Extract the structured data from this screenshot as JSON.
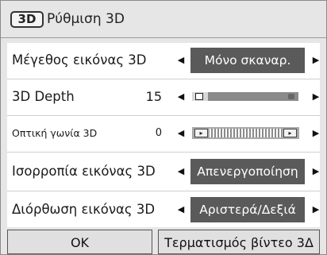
{
  "title": {
    "logo_text": "3D",
    "text": "Ρύθμιση 3D"
  },
  "rows": [
    {
      "label": "Μέγεθος εικόνας 3D",
      "value": "",
      "control": "select",
      "selected": "Μόνο σκαναρ."
    },
    {
      "label": "3D Depth",
      "value": "15",
      "control": "slider",
      "level_fraction": 0.15
    },
    {
      "label": "Οπτική γωνία 3D",
      "value": "0",
      "control": "hatch-slider"
    },
    {
      "label": "Ισορροπία εικόνας 3D",
      "value": "",
      "control": "select",
      "selected": "Απενεργοποίηση"
    },
    {
      "label": "Διόρθωση εικόνας 3D",
      "value": "",
      "control": "select",
      "selected": "Αριστερά/Δεξιά"
    }
  ],
  "arrows": {
    "left_icon": "triangle-left-icon",
    "right_icon": "triangle-right-icon",
    "left_glyph": "◀",
    "right_glyph": "▶"
  },
  "buttons": {
    "ok": "OK",
    "end": "Τερματισμός βίντεο 3Δ"
  },
  "colors": {
    "panel_bg": "#e6e6e6",
    "content_bg": "#ffffff",
    "selected_bg": "#5a5a5a",
    "selected_text": "#ffffff"
  }
}
